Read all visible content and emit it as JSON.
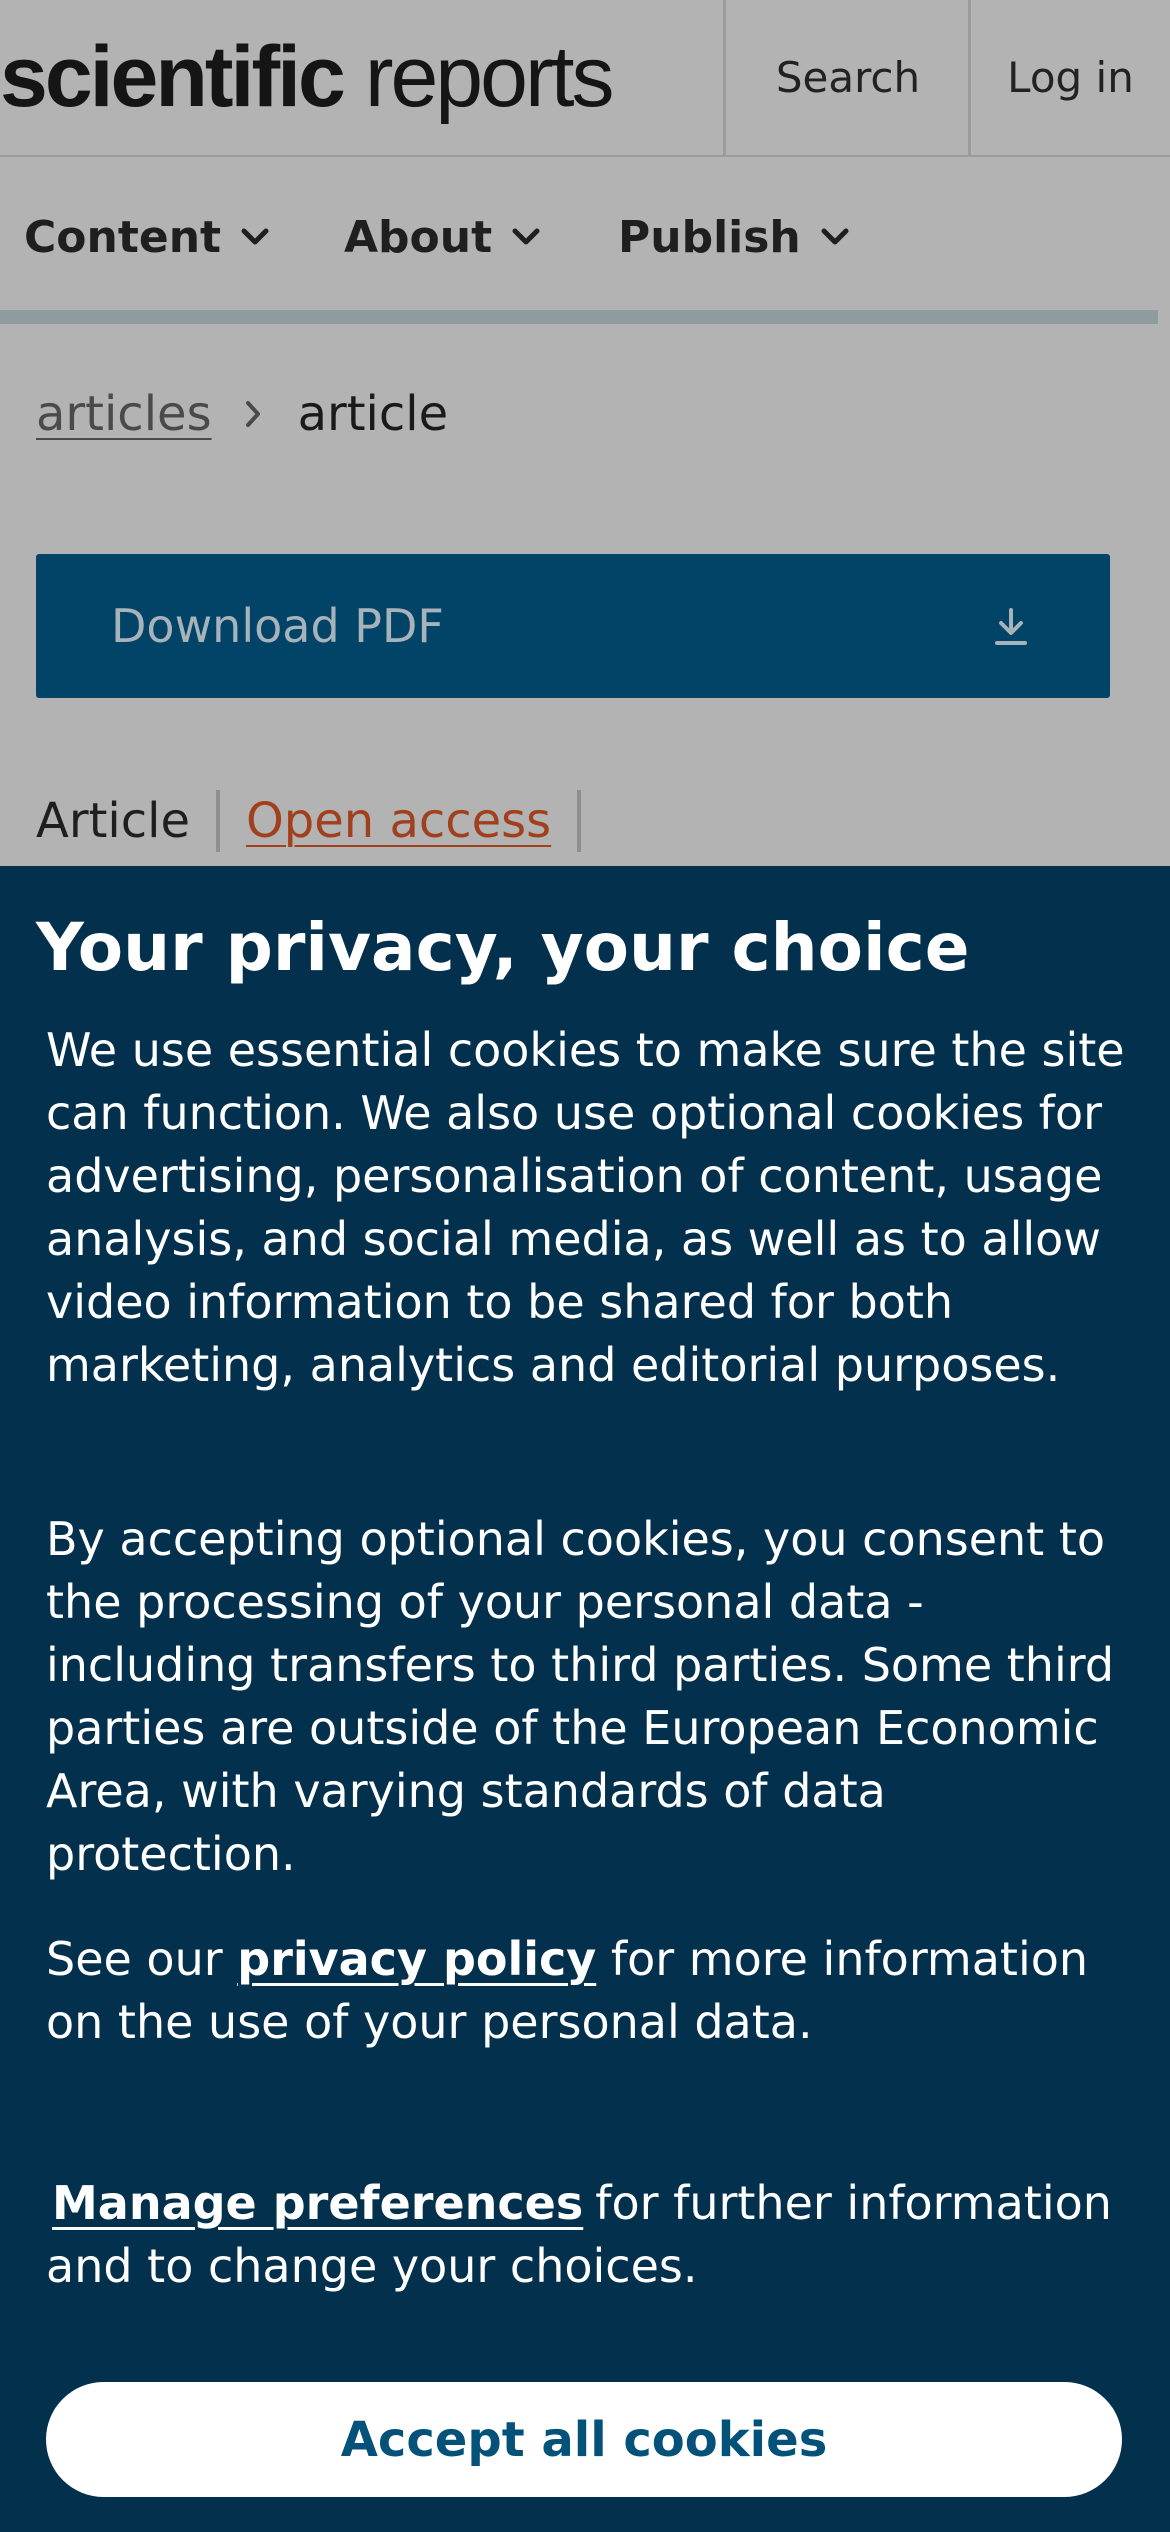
{
  "header": {
    "logo_bold": "scientific",
    "logo_light": "reports",
    "search_label": "Search",
    "login_label": "Log in"
  },
  "nav": {
    "items": [
      {
        "label": "Content",
        "icon": "chevron-down-icon"
      },
      {
        "label": "About",
        "icon": "chevron-down-icon"
      },
      {
        "label": "Publish",
        "icon": "chevron-down-icon"
      }
    ]
  },
  "breadcrumb": {
    "link": "articles",
    "separator_icon": "chevron-right-icon",
    "current": "article"
  },
  "download": {
    "label": "Download PDF",
    "icon": "download-icon"
  },
  "meta": {
    "type": "Article",
    "access": "Open access"
  },
  "cookie_banner": {
    "title": "Your privacy, your choice",
    "paragraph1": "We use essential cookies to make sure the site can function. We also use optional cookies for advertising, personalisation of content, usage analysis, and social media, as well as to allow video information to be shared for both marketing, analytics and editorial purposes.",
    "paragraph2": "By accepting optional cookies, you consent to the processing of your personal data - including transfers to third parties. Some third parties are outside of the European Economic Area, with varying standards of data protection.",
    "paragraph3_prefix": "See our",
    "privacy_link": "privacy policy",
    "paragraph3_suffix": "for more information on the use of your personal data.",
    "manage_link": "Manage preferences",
    "paragraph4_suffix": "for further information and to change your choices.",
    "accept_label": "Accept all cookies"
  },
  "colors": {
    "page_dimmed": "#b3b3b3",
    "download_button": "#024467",
    "open_access": "#a0401c",
    "banner_bg": "#03314d",
    "accept_text": "#04527a"
  }
}
